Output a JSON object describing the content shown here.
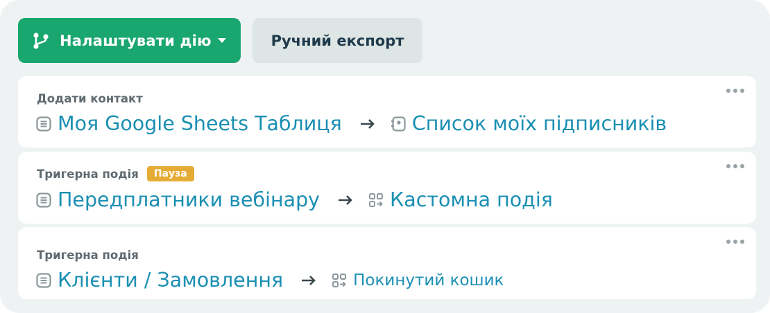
{
  "toolbar": {
    "configure_label": "Налаштувати дію",
    "export_label": "Ручний експорт"
  },
  "rules": [
    {
      "kind": "Додати контакт",
      "badge": "",
      "source": "Моя Google Sheets Таблиця",
      "source_icon": "sheet-icon",
      "target": "Список моїх підписників",
      "target_icon": "contact-list-icon"
    },
    {
      "kind": "Тригерна подія",
      "badge": "Пауза",
      "source": "Передплатники вебінару",
      "source_icon": "sheet-icon",
      "target": "Кастомна подія",
      "target_icon": "custom-event-icon"
    },
    {
      "kind": "Тригерна подія",
      "badge": "",
      "source": "Клієнти / Замовлення",
      "source_icon": "sheet-icon",
      "target": "Покинутий кошик",
      "target_icon": "custom-event-icon"
    }
  ],
  "colors": {
    "primary": "#1aa66f",
    "secondary_bg": "#dde5e5",
    "link": "#1a8fb3",
    "badge_paused": "#e5ac35",
    "panel_bg": "#eef2f2"
  }
}
